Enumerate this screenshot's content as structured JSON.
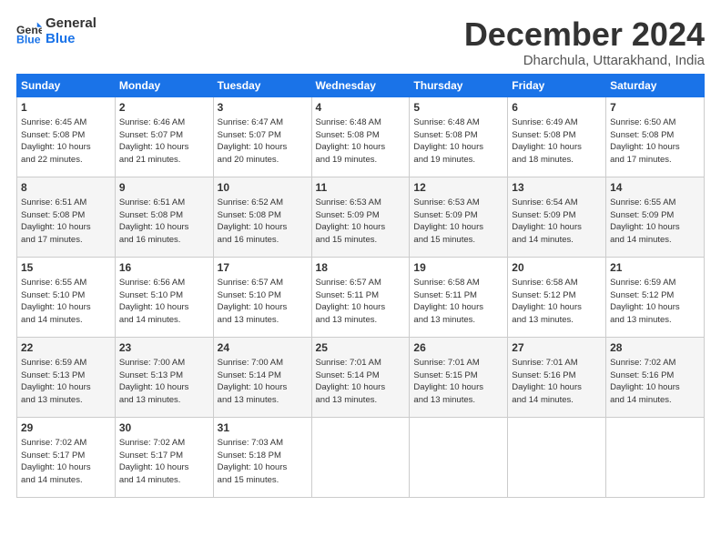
{
  "logo": {
    "line1": "General",
    "line2": "Blue"
  },
  "title": "December 2024",
  "subtitle": "Dharchula, Uttarakhand, India",
  "headers": [
    "Sunday",
    "Monday",
    "Tuesday",
    "Wednesday",
    "Thursday",
    "Friday",
    "Saturday"
  ],
  "weeks": [
    [
      {
        "day": "1",
        "info": "Sunrise: 6:45 AM\nSunset: 5:08 PM\nDaylight: 10 hours\nand 22 minutes."
      },
      {
        "day": "2",
        "info": "Sunrise: 6:46 AM\nSunset: 5:07 PM\nDaylight: 10 hours\nand 21 minutes."
      },
      {
        "day": "3",
        "info": "Sunrise: 6:47 AM\nSunset: 5:07 PM\nDaylight: 10 hours\nand 20 minutes."
      },
      {
        "day": "4",
        "info": "Sunrise: 6:48 AM\nSunset: 5:08 PM\nDaylight: 10 hours\nand 19 minutes."
      },
      {
        "day": "5",
        "info": "Sunrise: 6:48 AM\nSunset: 5:08 PM\nDaylight: 10 hours\nand 19 minutes."
      },
      {
        "day": "6",
        "info": "Sunrise: 6:49 AM\nSunset: 5:08 PM\nDaylight: 10 hours\nand 18 minutes."
      },
      {
        "day": "7",
        "info": "Sunrise: 6:50 AM\nSunset: 5:08 PM\nDaylight: 10 hours\nand 17 minutes."
      }
    ],
    [
      {
        "day": "8",
        "info": "Sunrise: 6:51 AM\nSunset: 5:08 PM\nDaylight: 10 hours\nand 17 minutes."
      },
      {
        "day": "9",
        "info": "Sunrise: 6:51 AM\nSunset: 5:08 PM\nDaylight: 10 hours\nand 16 minutes."
      },
      {
        "day": "10",
        "info": "Sunrise: 6:52 AM\nSunset: 5:08 PM\nDaylight: 10 hours\nand 16 minutes."
      },
      {
        "day": "11",
        "info": "Sunrise: 6:53 AM\nSunset: 5:09 PM\nDaylight: 10 hours\nand 15 minutes."
      },
      {
        "day": "12",
        "info": "Sunrise: 6:53 AM\nSunset: 5:09 PM\nDaylight: 10 hours\nand 15 minutes."
      },
      {
        "day": "13",
        "info": "Sunrise: 6:54 AM\nSunset: 5:09 PM\nDaylight: 10 hours\nand 14 minutes."
      },
      {
        "day": "14",
        "info": "Sunrise: 6:55 AM\nSunset: 5:09 PM\nDaylight: 10 hours\nand 14 minutes."
      }
    ],
    [
      {
        "day": "15",
        "info": "Sunrise: 6:55 AM\nSunset: 5:10 PM\nDaylight: 10 hours\nand 14 minutes."
      },
      {
        "day": "16",
        "info": "Sunrise: 6:56 AM\nSunset: 5:10 PM\nDaylight: 10 hours\nand 14 minutes."
      },
      {
        "day": "17",
        "info": "Sunrise: 6:57 AM\nSunset: 5:10 PM\nDaylight: 10 hours\nand 13 minutes."
      },
      {
        "day": "18",
        "info": "Sunrise: 6:57 AM\nSunset: 5:11 PM\nDaylight: 10 hours\nand 13 minutes."
      },
      {
        "day": "19",
        "info": "Sunrise: 6:58 AM\nSunset: 5:11 PM\nDaylight: 10 hours\nand 13 minutes."
      },
      {
        "day": "20",
        "info": "Sunrise: 6:58 AM\nSunset: 5:12 PM\nDaylight: 10 hours\nand 13 minutes."
      },
      {
        "day": "21",
        "info": "Sunrise: 6:59 AM\nSunset: 5:12 PM\nDaylight: 10 hours\nand 13 minutes."
      }
    ],
    [
      {
        "day": "22",
        "info": "Sunrise: 6:59 AM\nSunset: 5:13 PM\nDaylight: 10 hours\nand 13 minutes."
      },
      {
        "day": "23",
        "info": "Sunrise: 7:00 AM\nSunset: 5:13 PM\nDaylight: 10 hours\nand 13 minutes."
      },
      {
        "day": "24",
        "info": "Sunrise: 7:00 AM\nSunset: 5:14 PM\nDaylight: 10 hours\nand 13 minutes."
      },
      {
        "day": "25",
        "info": "Sunrise: 7:01 AM\nSunset: 5:14 PM\nDaylight: 10 hours\nand 13 minutes."
      },
      {
        "day": "26",
        "info": "Sunrise: 7:01 AM\nSunset: 5:15 PM\nDaylight: 10 hours\nand 13 minutes."
      },
      {
        "day": "27",
        "info": "Sunrise: 7:01 AM\nSunset: 5:16 PM\nDaylight: 10 hours\nand 14 minutes."
      },
      {
        "day": "28",
        "info": "Sunrise: 7:02 AM\nSunset: 5:16 PM\nDaylight: 10 hours\nand 14 minutes."
      }
    ],
    [
      {
        "day": "29",
        "info": "Sunrise: 7:02 AM\nSunset: 5:17 PM\nDaylight: 10 hours\nand 14 minutes."
      },
      {
        "day": "30",
        "info": "Sunrise: 7:02 AM\nSunset: 5:17 PM\nDaylight: 10 hours\nand 14 minutes."
      },
      {
        "day": "31",
        "info": "Sunrise: 7:03 AM\nSunset: 5:18 PM\nDaylight: 10 hours\nand 15 minutes."
      },
      null,
      null,
      null,
      null
    ]
  ]
}
